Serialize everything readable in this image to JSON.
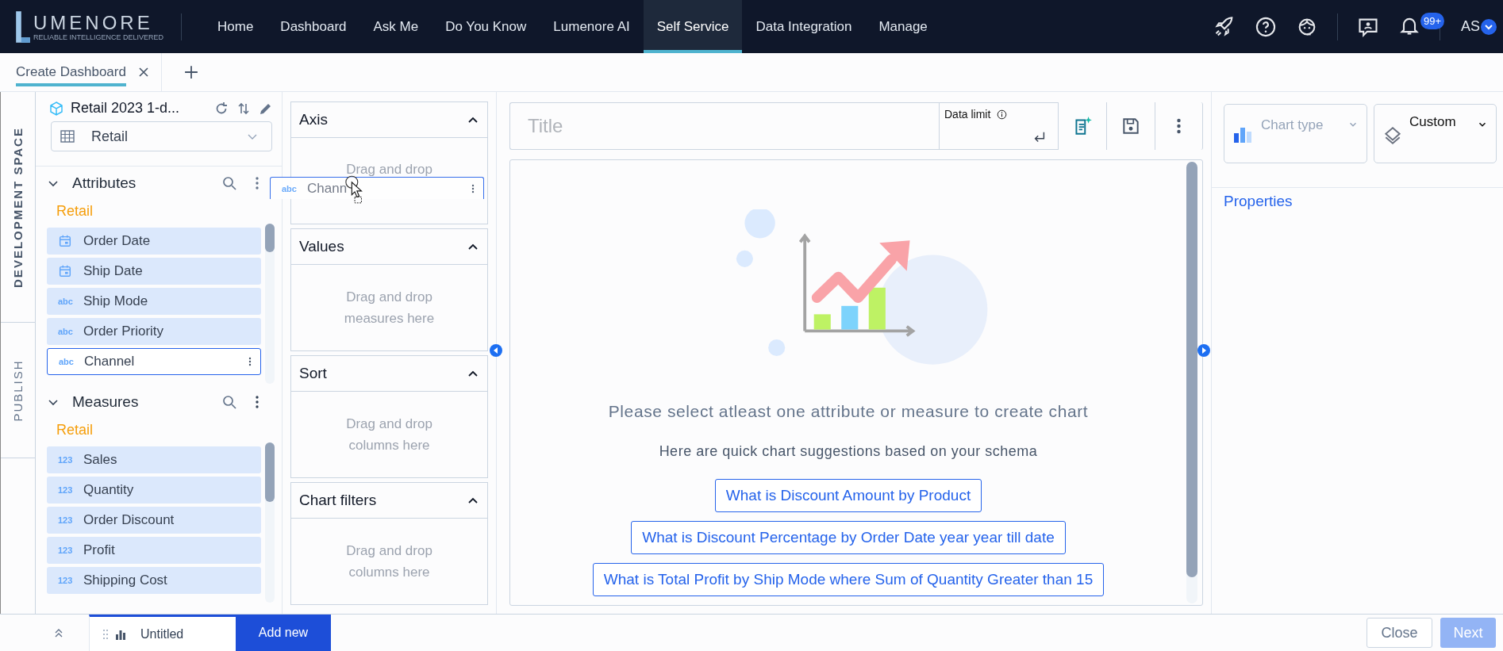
{
  "logo": {
    "name": "UMENORE",
    "tagline": "RELIABLE INTELLIGENCE DELIVERED"
  },
  "nav": [
    {
      "label": "Home",
      "selected": false
    },
    {
      "label": "Dashboard",
      "selected": false
    },
    {
      "label": "Ask Me",
      "selected": false
    },
    {
      "label": "Do You Know",
      "selected": false
    },
    {
      "label": "Lumenore AI",
      "selected": false
    },
    {
      "label": "Self Service",
      "selected": true
    },
    {
      "label": "Data Integration",
      "selected": false
    },
    {
      "label": "Manage",
      "selected": false
    }
  ],
  "notifications": {
    "count": "99+"
  },
  "user": {
    "initials": "AS"
  },
  "doc_tabs": [
    {
      "label": "Create Dashboard",
      "selected": true
    }
  ],
  "side_tabs": [
    {
      "label": "DEVELOPMENT SPACE",
      "selected": true
    },
    {
      "label": "PUBLISH",
      "selected": false
    }
  ],
  "source": {
    "name": "Retail 2023 1-d...",
    "table": "Retail"
  },
  "attributes": {
    "title": "Attributes",
    "expanded": true,
    "group": "Retail",
    "items": [
      {
        "label": "Order Date",
        "kind": "date",
        "selected": false
      },
      {
        "label": "Ship Date",
        "kind": "date",
        "selected": false
      },
      {
        "label": "Ship Mode",
        "kind": "text",
        "badge": "abc",
        "selected": false
      },
      {
        "label": "Order Priority",
        "kind": "text",
        "badge": "abc",
        "selected": false
      },
      {
        "label": "Channel",
        "kind": "text",
        "badge": "abc",
        "selected": true
      }
    ]
  },
  "measures": {
    "title": "Measures",
    "expanded": true,
    "group": "Retail",
    "items": [
      {
        "label": "Sales",
        "kind": "number",
        "badge": "123",
        "selected": false
      },
      {
        "label": "Quantity",
        "kind": "number",
        "badge": "123",
        "selected": false
      },
      {
        "label": "Order Discount",
        "kind": "number",
        "badge": "123",
        "selected": false
      },
      {
        "label": "Profit",
        "kind": "number",
        "badge": "123",
        "selected": false
      },
      {
        "label": "Shipping Cost",
        "kind": "number",
        "badge": "123",
        "selected": false
      }
    ]
  },
  "drag_ghost": {
    "label": "Chann",
    "badge": "abc"
  },
  "drop_zones": [
    {
      "title": "Axis",
      "expanded": true,
      "hint": "Drag and drop"
    },
    {
      "title": "Values",
      "expanded": true,
      "hint": "Drag and drop measures here"
    },
    {
      "title": "Sort",
      "expanded": true,
      "hint": "Drag and drop columns here"
    },
    {
      "title": "Chart filters",
      "expanded": true,
      "hint": "Drag and drop columns here"
    }
  ],
  "chart_header": {
    "title_placeholder": "Title",
    "data_limit_label": "Data limit"
  },
  "canvas": {
    "message": "Please select atleast one attribute or measure to create chart",
    "intro": "Here are quick chart suggestions based on your schema",
    "suggestions": [
      "What is Discount Amount by Product",
      "What is Discount Percentage by Order Date year year till date",
      "What is Total Profit by Ship Mode where Sum of Quantity Greater than 15"
    ]
  },
  "right_panel": {
    "chart_type_placeholder": "Chart type",
    "layout": "Custom",
    "section": "Properties"
  },
  "bottom": {
    "sheets": [
      {
        "label": "Untitled",
        "selected": true
      }
    ],
    "add_label": "Add new",
    "close_label": "Close",
    "next_label": "Next",
    "next_disabled": true
  }
}
